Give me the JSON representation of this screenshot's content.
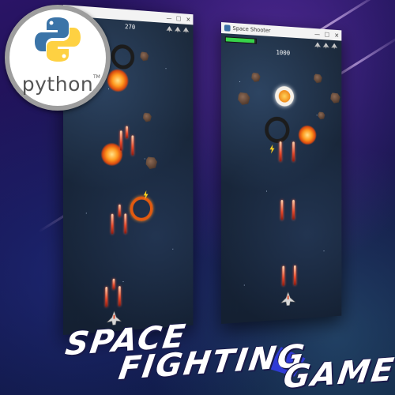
{
  "python_badge": {
    "wordmark": "python",
    "trademark": "TM",
    "colors": {
      "blue": "#3b74a8",
      "yellow": "#fed142",
      "ring": "#9d9d9d"
    }
  },
  "left_window": {
    "title": "",
    "score": "270",
    "lives": 3,
    "controls": {
      "minimize": "—",
      "maximize": "☐",
      "close": "✕"
    }
  },
  "right_window": {
    "title": "Space Shooter",
    "score": "1000",
    "lives": 3,
    "health_percent": 95,
    "controls": {
      "minimize": "—",
      "maximize": "☐",
      "close": "✕"
    }
  },
  "game_title": {
    "line1": "SPACE",
    "line2": "FIGHTING",
    "line3": "GAME",
    "accent_color": "#2f3bd6"
  },
  "colors": {
    "background": "#1c1456",
    "playfield": "#18263a",
    "laser": "#e8482a",
    "explosion": "#ff9a1f",
    "health": "#37d34a"
  }
}
